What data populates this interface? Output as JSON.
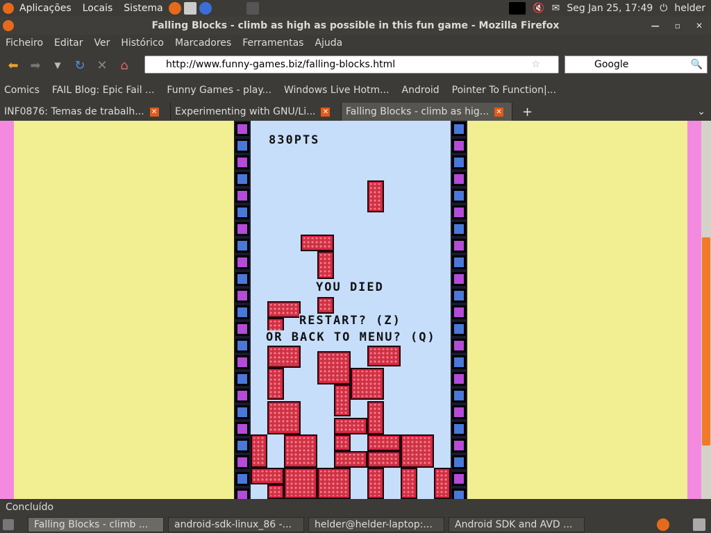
{
  "top_panel": {
    "menus": [
      "Aplicações",
      "Locais",
      "Sistema"
    ],
    "datetime": "Seg Jan 25, 17:49",
    "user": "helder"
  },
  "window": {
    "title": "Falling Blocks - climb as high as possible in this fun game - Mozilla Firefox"
  },
  "menubar": [
    "Ficheiro",
    "Editar",
    "Ver",
    "Histórico",
    "Marcadores",
    "Ferramentas",
    "Ajuda"
  ],
  "nav": {
    "url": "http://www.funny-games.biz/falling-blocks.html",
    "search": "Google"
  },
  "bookmarks": [
    "Comics",
    "FAIL Blog: Epic Fail ...",
    "Funny Games - play...",
    "Windows Live Hotm...",
    "Android",
    "Pointer To Function|..."
  ],
  "tabs": [
    "INF0876: Temas de trabalh...",
    "Experimenting with GNU/Li...",
    "Falling Blocks - climb as hig..."
  ],
  "game": {
    "score": "830PTS",
    "died": "YOU DIED",
    "restart": "RESTART? (Z)",
    "menu": "OR BACK TO MENU? (Q)"
  },
  "status": "Concluído",
  "taskbar": [
    "Falling Blocks - climb ...",
    "android-sdk-linux_86 -...",
    "helder@helder-laptop:...",
    "Android SDK and AVD ..."
  ],
  "colors": {
    "page_bg": "#f2ee92",
    "side": "#f48ae0",
    "sky": "#c6defa",
    "block": "#cc3344"
  }
}
